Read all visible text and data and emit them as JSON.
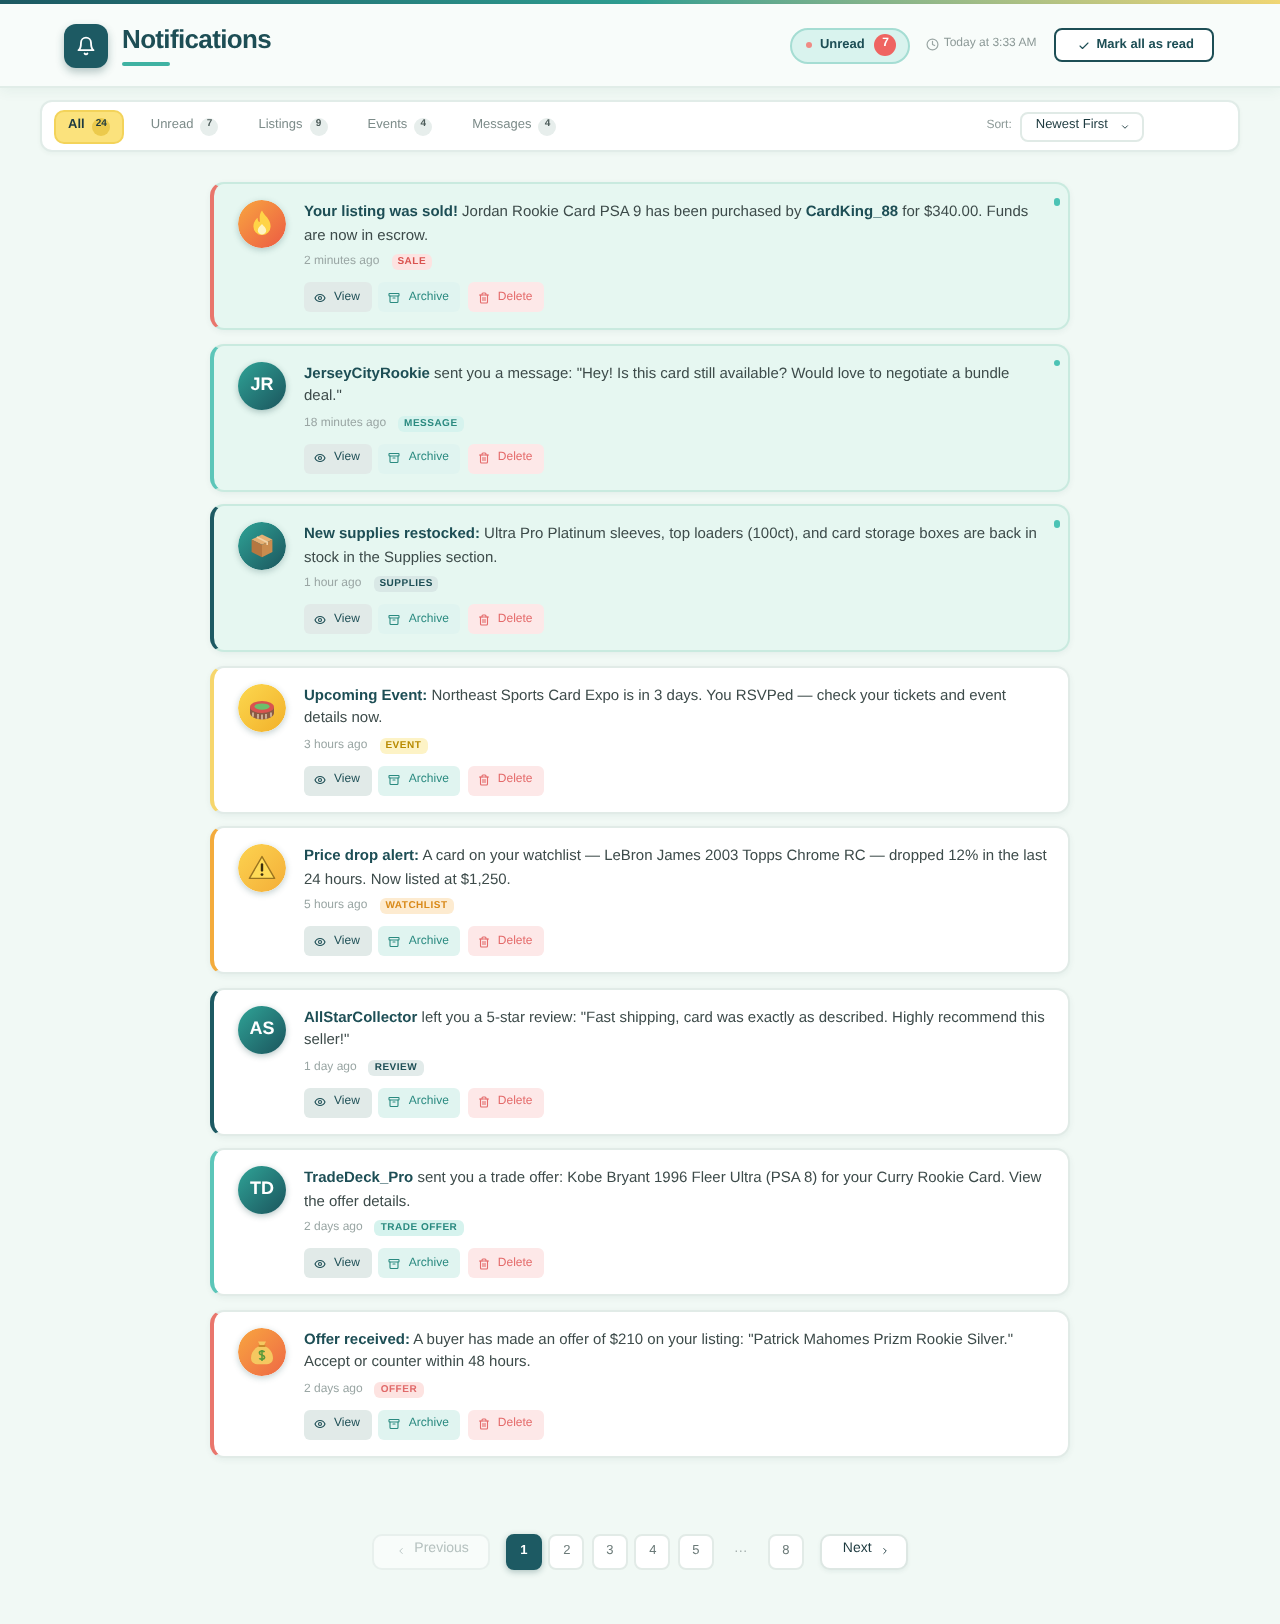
{
  "header": {
    "title": "Notifications",
    "unread_toggle": {
      "label": "Unread",
      "count": "7"
    },
    "timestamp": "Today at 3:33 AM",
    "mark_all_button": "Mark all as read"
  },
  "filter_tabs": [
    {
      "label": "All",
      "count": "24",
      "selected": true
    },
    {
      "label": "Unread",
      "count": "7",
      "selected": false
    },
    {
      "label": "Listings",
      "count": "9",
      "selected": false
    },
    {
      "label": "Events",
      "count": "4",
      "selected": false
    },
    {
      "label": "Messages",
      "count": "4",
      "selected": false
    }
  ],
  "sort": {
    "label": "Sort:",
    "value": "Newest First"
  },
  "notifications": [
    {
      "kind": "sale",
      "unread": true,
      "text": "**Your listing was sold!** Jordan Rookie Card PSA 9 has been purchased by **CardKing_88** for $340.00. Funds are now in escrow.",
      "time": "2 minutes ago",
      "tag": "SALE",
      "actions": [
        {
          "kind": "view",
          "label": "View"
        },
        {
          "kind": "archive",
          "label": "Archive"
        },
        {
          "kind": "delete",
          "label": "Delete"
        }
      ]
    },
    {
      "kind": "message",
      "unread": true,
      "initials": "JR",
      "text": "**JerseyCityRookie** sent you a message: \"Hey! Is this card still available? Would love to negotiate a bundle deal.\"",
      "time": "18 minutes ago",
      "tag": "MESSAGE",
      "actions": [
        {
          "kind": "view",
          "label": "View"
        },
        {
          "kind": "archive",
          "label": "Archive"
        },
        {
          "kind": "delete",
          "label": "Delete"
        }
      ]
    },
    {
      "kind": "supplies",
      "unread": true,
      "text": "**New supplies restocked:** Ultra Pro Platinum sleeves, top loaders (100ct), and card storage boxes are back in stock in the Supplies section.",
      "time": "1 hour ago",
      "tag": "SUPPLIES",
      "actions": [
        {
          "kind": "view",
          "label": "View"
        },
        {
          "kind": "archive",
          "label": "Archive"
        },
        {
          "kind": "delete",
          "label": "Delete"
        }
      ]
    },
    {
      "kind": "event",
      "unread": false,
      "text": "**Upcoming Event:** Northeast Sports Card Expo is in 3 days. You RSVPed — check your tickets and event details now.",
      "time": "3 hours ago",
      "tag": "EVENT",
      "actions": [
        {
          "kind": "view",
          "label": "View"
        },
        {
          "kind": "archive",
          "label": "Archive"
        },
        {
          "kind": "delete",
          "label": "Delete"
        }
      ]
    },
    {
      "kind": "watchlist",
      "unread": false,
      "text": "**Price drop alert:** A card on your watchlist — LeBron James 2003 Topps Chrome RC — dropped 12% in the last 24 hours. Now listed at $1,250.",
      "time": "5 hours ago",
      "tag": "WATCHLIST",
      "actions": [
        {
          "kind": "view",
          "label": "View"
        },
        {
          "kind": "archive",
          "label": "Archive"
        },
        {
          "kind": "delete",
          "label": "Delete"
        }
      ]
    },
    {
      "kind": "review",
      "unread": false,
      "initials": "AS",
      "text": "**AllStarCollector** left you a 5-star review: \"Fast shipping, card was exactly as described. Highly recommend this seller!\"",
      "time": "1 day ago",
      "tag": "REVIEW",
      "actions": [
        {
          "kind": "view",
          "label": "View"
        },
        {
          "kind": "archive",
          "label": "Archive"
        },
        {
          "kind": "delete",
          "label": "Delete"
        }
      ]
    },
    {
      "kind": "trade",
      "unread": false,
      "initials": "TD",
      "text": "**TradeDeck_Pro** sent you a trade offer: Kobe Bryant 1996 Fleer Ultra (PSA 8) for your Curry Rookie Card. View the offer details.",
      "time": "2 days ago",
      "tag": "TRADE OFFER",
      "actions": [
        {
          "kind": "view",
          "label": "View"
        },
        {
          "kind": "archive",
          "label": "Archive"
        },
        {
          "kind": "delete",
          "label": "Delete"
        }
      ]
    },
    {
      "kind": "offer",
      "unread": false,
      "text": "**Offer received:** A buyer has made an offer of $210 on your listing: \"Patrick Mahomes Prizm Rookie Silver.\" Accept or counter within 48 hours.",
      "time": "2 days ago",
      "tag": "OFFER",
      "actions": [
        {
          "kind": "view",
          "label": "View"
        },
        {
          "kind": "archive",
          "label": "Archive"
        },
        {
          "kind": "delete",
          "label": "Delete"
        }
      ]
    }
  ],
  "pagination": {
    "previous": {
      "label": "Previous",
      "disabled": true
    },
    "pages": [
      {
        "label": "1",
        "selected": true
      },
      {
        "label": "2",
        "selected": false
      },
      {
        "label": "3",
        "selected": false
      },
      {
        "label": "4",
        "selected": false
      },
      {
        "label": "5",
        "selected": false
      }
    ],
    "ellipsis": "…",
    "last_pages": [
      {
        "label": "8",
        "selected": false
      }
    ],
    "next": {
      "label": "Next",
      "disabled": false
    }
  }
}
